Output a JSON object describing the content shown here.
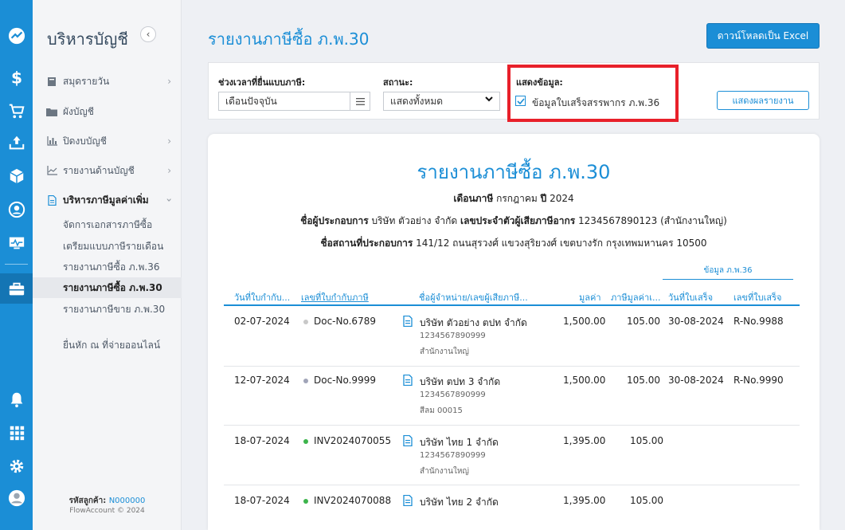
{
  "sidebar": {
    "title": "บริหารบัญชี",
    "items": [
      {
        "label": "สมุดรายวัน"
      },
      {
        "label": "ผังบัญชี"
      },
      {
        "label": "ปิดงบบัญชี"
      },
      {
        "label": "รายงานด้านบัญชี"
      },
      {
        "label": "บริหารภาษีมูลค่าเพิ่ม"
      }
    ],
    "subitems": [
      {
        "label": "จัดการเอกสารภาษีซื้อ"
      },
      {
        "label": "เตรียมแบบภาษีรายเดือน"
      },
      {
        "label": "รายงานภาษีซื้อ ภ.พ.36"
      },
      {
        "label": "รายงานภาษีซื้อ ภ.พ.30"
      },
      {
        "label": "รายงานภาษีขาย ภ.พ.30"
      },
      {
        "label": "ยื่นหัก ณ ที่จ่ายออนไลน์"
      }
    ],
    "footer_label": "รหัสลูกค้า:",
    "footer_code": "N000000",
    "footer_copy": "FlowAccount  © 2024"
  },
  "header": {
    "title": "รายงานภาษีซื้อ ภ.พ.30",
    "excel_button": "ดาวน์โหลดเป็น Excel"
  },
  "filters": {
    "period_label": "ช่วงเวลาที่ยื่นแบบภาษี:",
    "period_value": "เดือนปัจจุบัน",
    "status_label": "สถานะ:",
    "status_value": "แสดงทั้งหมด",
    "display_label": "แสดงข้อมูล:",
    "display_checkbox": "ข้อมูลใบเสร็จสรรพากร ภ.พ.36",
    "display_checked": true,
    "show_button": "แสดงผลรายงาน"
  },
  "report": {
    "title": "รายงานภาษีซื้อ ภ.พ.30",
    "month_label": "เดือนภาษี",
    "month_value": "กรกฎาคม",
    "year_label": "ปี",
    "year_value": "2024",
    "operator_label": "ชื่อผู้ประกอบการ",
    "operator_value": "บริษัท ตัวอย่าง จำกัด",
    "taxid_label": "เลขประจำตัวผู้เสียภาษีอากร",
    "taxid_value": "1234567890123 (สำนักงานใหญ่)",
    "address_label": "ชื่อสถานที่ประกอบการ",
    "address_value": "141/12 ถนนสุรวงศ์ แขวงสุริยวงศ์ เขตบางรัก กรุงเทพมหานคร 10500",
    "group_label": "ข้อมูล ภ.พ.36",
    "columns": [
      "วันที่ใบกำกับ...",
      "เลขที่ใบกำกับภาษี",
      "ชื่อผู้จำหน่าย/เลขผู้เสียภาษี...",
      "มูลค่า",
      "ภาษีมูลค่าเ...",
      "วันที่ใบเสร็จ",
      "เลขที่ใบเสร็จ"
    ],
    "rows": [
      {
        "date": "02-07-2024",
        "doc": "Doc-No.6789",
        "dot": "#c8c8c8",
        "vendor": "บริษัท ตัวอย่าง ตปท จำกัด",
        "taxid": "1234567890999",
        "branch": "สำนักงานใหญ่",
        "amount": "1,500.00",
        "vat": "105.00",
        "rdate": "30-08-2024",
        "rno": "R-No.9988"
      },
      {
        "date": "12-07-2024",
        "doc": "Doc-No.9999",
        "dot": "#a0a4b8",
        "vendor": "บริษัท ตปท 3 จำกัด",
        "taxid": "1234567890999",
        "branch": "สีลม 00015",
        "amount": "1,500.00",
        "vat": "105.00",
        "rdate": "30-08-2024",
        "rno": "R-No.9990"
      },
      {
        "date": "18-07-2024",
        "doc": "INV2024070055",
        "dot": "#3cb44b",
        "vendor": "บริษัท ไทย 1 จำกัด",
        "taxid": "1234567890999",
        "branch": "สำนักงานใหญ่",
        "amount": "1,395.00",
        "vat": "105.00",
        "rdate": "",
        "rno": ""
      },
      {
        "date": "18-07-2024",
        "doc": "INV2024070088",
        "dot": "#3cb44b",
        "vendor": "บริษัท ไทย 2 จำกัด",
        "taxid": "",
        "branch": "",
        "amount": "1,395.00",
        "vat": "105.00",
        "rdate": "",
        "rno": ""
      }
    ]
  },
  "colors": {
    "accent": "#1b8ed6",
    "highlight": "#e8202a"
  }
}
